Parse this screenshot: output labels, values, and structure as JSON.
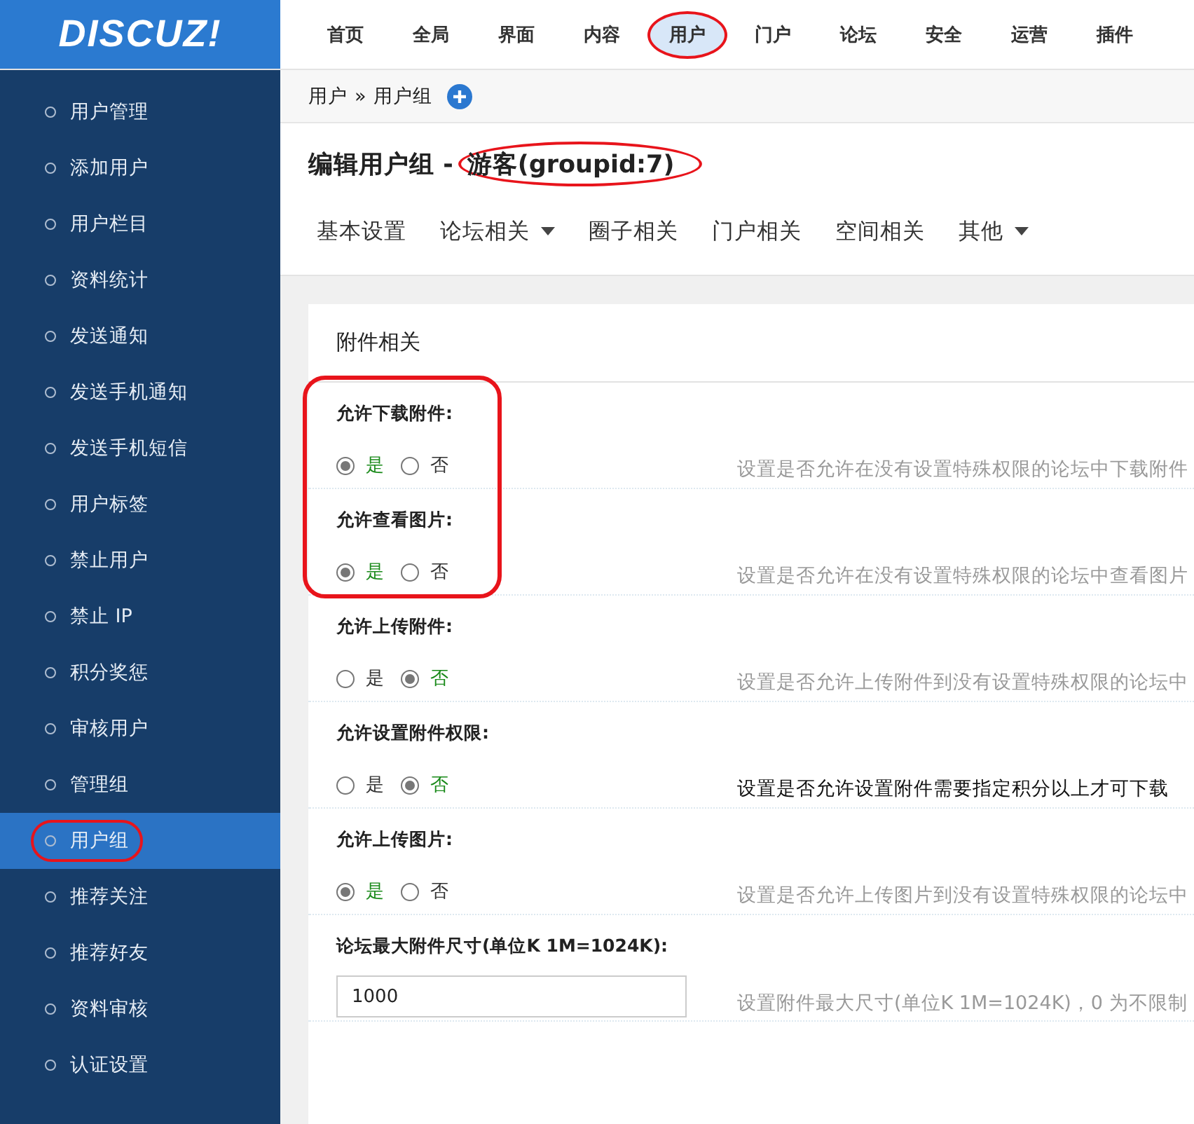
{
  "logo": "DISCUZ!",
  "top_nav": [
    {
      "label": "首页",
      "selected": false,
      "annotated": false
    },
    {
      "label": "全局",
      "selected": false,
      "annotated": false
    },
    {
      "label": "界面",
      "selected": false,
      "annotated": false
    },
    {
      "label": "内容",
      "selected": false,
      "annotated": false
    },
    {
      "label": "用户",
      "selected": true,
      "annotated": true
    },
    {
      "label": "门户",
      "selected": false,
      "annotated": false
    },
    {
      "label": "论坛",
      "selected": false,
      "annotated": false
    },
    {
      "label": "安全",
      "selected": false,
      "annotated": false
    },
    {
      "label": "运营",
      "selected": false,
      "annotated": false
    },
    {
      "label": "插件",
      "selected": false,
      "annotated": false
    }
  ],
  "sidebar": {
    "items": [
      {
        "label": "用户管理",
        "selected": false,
        "annotated": false
      },
      {
        "label": "添加用户",
        "selected": false,
        "annotated": false
      },
      {
        "label": "用户栏目",
        "selected": false,
        "annotated": false
      },
      {
        "label": "资料统计",
        "selected": false,
        "annotated": false
      },
      {
        "label": "发送通知",
        "selected": false,
        "annotated": false
      },
      {
        "label": "发送手机通知",
        "selected": false,
        "annotated": false
      },
      {
        "label": "发送手机短信",
        "selected": false,
        "annotated": false
      },
      {
        "label": "用户标签",
        "selected": false,
        "annotated": false
      },
      {
        "label": "禁止用户",
        "selected": false,
        "annotated": false
      },
      {
        "label": "禁止 IP",
        "selected": false,
        "annotated": false
      },
      {
        "label": "积分奖惩",
        "selected": false,
        "annotated": false
      },
      {
        "label": "审核用户",
        "selected": false,
        "annotated": false
      },
      {
        "label": "管理组",
        "selected": false,
        "annotated": false
      },
      {
        "label": "用户组",
        "selected": true,
        "annotated": true
      },
      {
        "label": "推荐关注",
        "selected": false,
        "annotated": false
      },
      {
        "label": "推荐好友",
        "selected": false,
        "annotated": false
      },
      {
        "label": "资料审核",
        "selected": false,
        "annotated": false
      },
      {
        "label": "认证设置",
        "selected": false,
        "annotated": false
      }
    ]
  },
  "breadcrumb": {
    "items": [
      "用户",
      "用户组"
    ],
    "separator": "»"
  },
  "title": {
    "prefix": "编辑用户组 -",
    "name": "游客(groupid:7)",
    "annotated": true
  },
  "tabs": [
    {
      "label": "基本设置",
      "dropdown": false
    },
    {
      "label": "论坛相关",
      "dropdown": true
    },
    {
      "label": "圈子相关",
      "dropdown": false
    },
    {
      "label": "门户相关",
      "dropdown": false
    },
    {
      "label": "空间相关",
      "dropdown": false
    },
    {
      "label": "其他",
      "dropdown": true
    }
  ],
  "section": {
    "title": "附件相关",
    "groups": [
      {
        "annotated": true,
        "settings": [
          {
            "kind": "radio",
            "label": "允许下载附件:",
            "options": [
              {
                "label": "是",
                "selected": true
              },
              {
                "label": "否",
                "selected": false
              }
            ],
            "description": "设置是否允许在没有设置特殊权限的论坛中下载附件",
            "emphasis": false
          },
          {
            "kind": "radio",
            "label": "允许查看图片:",
            "options": [
              {
                "label": "是",
                "selected": true
              },
              {
                "label": "否",
                "selected": false
              }
            ],
            "description": "设置是否允许在没有设置特殊权限的论坛中查看图片",
            "emphasis": false
          }
        ]
      },
      {
        "annotated": false,
        "settings": [
          {
            "kind": "radio",
            "label": "允许上传附件:",
            "options": [
              {
                "label": "是",
                "selected": false
              },
              {
                "label": "否",
                "selected": true
              }
            ],
            "description": "设置是否允许上传附件到没有设置特殊权限的论坛中",
            "emphasis": false
          },
          {
            "kind": "radio",
            "label": "允许设置附件权限:",
            "options": [
              {
                "label": "是",
                "selected": false
              },
              {
                "label": "否",
                "selected": true
              }
            ],
            "description": "设置是否允许设置附件需要指定积分以上才可下载",
            "emphasis": true
          },
          {
            "kind": "radio",
            "label": "允许上传图片:",
            "options": [
              {
                "label": "是",
                "selected": true
              },
              {
                "label": "否",
                "selected": false
              }
            ],
            "description": "设置是否允许上传图片到没有设置特殊权限的论坛中",
            "emphasis": false
          },
          {
            "kind": "text",
            "label": "论坛最大附件尺寸(单位K 1M=1024K):",
            "value": "1000",
            "description": "设置附件最大尺寸(单位K 1M=1024K)，0 为不限制",
            "emphasis": false
          }
        ]
      }
    ]
  }
}
